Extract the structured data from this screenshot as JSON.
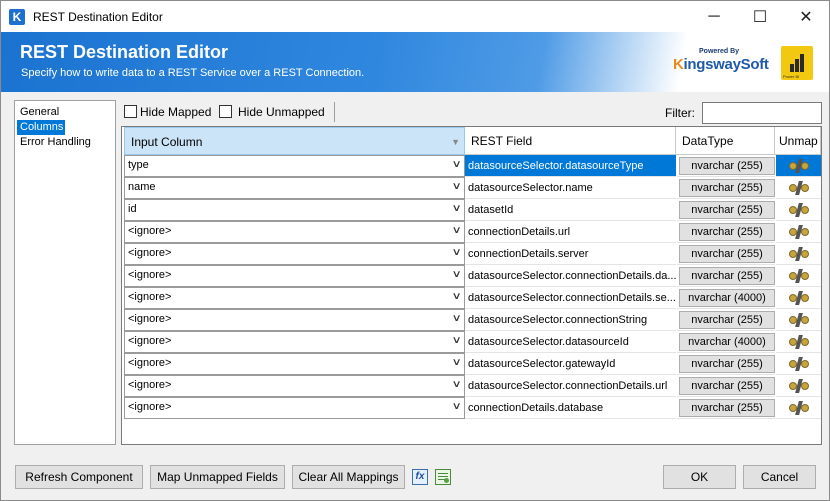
{
  "window": {
    "title": "REST Destination Editor"
  },
  "app_icon": {
    "glyph": "K"
  },
  "window_controls": {
    "minimize": "─",
    "maximize": "☐",
    "close": "✕"
  },
  "banner": {
    "title": "REST Destination Editor",
    "subtitle": "Specify how to write data to a REST Service over a REST Connection.",
    "logo_powered": "Powered By",
    "logo_k": "K",
    "logo_rest": "ingswaySoft",
    "pbi_label": "Power BI"
  },
  "nav": {
    "items": [
      "General",
      "Columns",
      "Error Handling"
    ],
    "active": "Columns"
  },
  "toolbar": {
    "hide_mapped": "Hide Mapped",
    "hide_unmapped": "Hide Unmapped",
    "filter_label": "Filter:",
    "filter_value": ""
  },
  "grid": {
    "headers": {
      "input": "Input Column",
      "rest": "REST Field",
      "dtype": "DataType",
      "unmap": "Unmap"
    },
    "rows": [
      {
        "input": "type",
        "rest": "datasourceSelector.datasourceType",
        "dtype": "nvarchar (255)"
      },
      {
        "input": "name",
        "rest": "datasourceSelector.name",
        "dtype": "nvarchar (255)"
      },
      {
        "input": "id",
        "rest": "datasetId",
        "dtype": "nvarchar (255)"
      },
      {
        "input": "<ignore>",
        "rest": "connectionDetails.url",
        "dtype": "nvarchar (255)"
      },
      {
        "input": "<ignore>",
        "rest": "connectionDetails.server",
        "dtype": "nvarchar (255)"
      },
      {
        "input": "<ignore>",
        "rest": "datasourceSelector.connectionDetails.da...",
        "dtype": "nvarchar (255)"
      },
      {
        "input": "<ignore>",
        "rest": "datasourceSelector.connectionDetails.se...",
        "dtype": "nvarchar (4000)"
      },
      {
        "input": "<ignore>",
        "rest": "datasourceSelector.connectionString",
        "dtype": "nvarchar (255)"
      },
      {
        "input": "<ignore>",
        "rest": "datasourceSelector.datasourceId",
        "dtype": "nvarchar (4000)"
      },
      {
        "input": "<ignore>",
        "rest": "datasourceSelector.gatewayId",
        "dtype": "nvarchar (255)"
      },
      {
        "input": "<ignore>",
        "rest": "datasourceSelector.connectionDetails.url",
        "dtype": "nvarchar (255)"
      },
      {
        "input": "<ignore>",
        "rest": "connectionDetails.database",
        "dtype": "nvarchar (255)"
      }
    ]
  },
  "buttons": {
    "refresh": "Refresh Component",
    "map_unmapped": "Map Unmapped Fields",
    "clear_all": "Clear All Mappings",
    "fx": "fx",
    "ok": "OK",
    "cancel": "Cancel"
  },
  "icons": {
    "unmap": "unplug-icon",
    "expression": "fx-icon",
    "grid_settings": "grid-settings-icon"
  },
  "colors": {
    "accent": "#0078d7",
    "banner": "#1b73d1"
  }
}
